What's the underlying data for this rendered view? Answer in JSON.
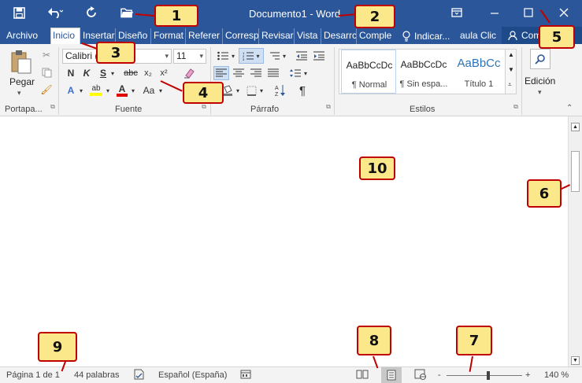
{
  "window": {
    "title": "Documento1 - Word",
    "qat": {
      "save_icon": "save-icon",
      "undo_icon": "undo-icon",
      "redo_icon": "redo-icon",
      "open_icon": "open-icon"
    },
    "controls": {
      "ribbon_display": "ribbon-display-icon",
      "minimize": "minimize-icon",
      "maximize": "maximize-icon",
      "close": "close-icon"
    }
  },
  "tabs": [
    {
      "label": "Archivo"
    },
    {
      "label": "Inicio"
    },
    {
      "label": "Insertar"
    },
    {
      "label": "Diseño"
    },
    {
      "label": "Format"
    },
    {
      "label": "Referer"
    },
    {
      "label": "Corresp"
    },
    {
      "label": "Revisar"
    },
    {
      "label": "Vista"
    },
    {
      "label": "Desarrc"
    },
    {
      "label": "Comple"
    }
  ],
  "tell_me": "Indicar...",
  "user": "aula Clic",
  "share": "Com",
  "ribbon": {
    "clipboard": {
      "paste_label": "Pegar",
      "group_label": "Portapa..."
    },
    "font": {
      "font_name": "Calibri (",
      "font_size": "11",
      "group_label": "Fuente",
      "bold": "N",
      "italic": "K",
      "underline": "S",
      "strike": "abc",
      "subscript": "x₂",
      "superscript": "x²",
      "change_case": "Aa"
    },
    "paragraph": {
      "group_label": "Párrafo"
    },
    "styles": {
      "group_label": "Estilos",
      "items": [
        {
          "sample": "AaBbCcDc",
          "name": "¶ Normal"
        },
        {
          "sample": "AaBbCcDc",
          "name": "¶ Sin espa..."
        },
        {
          "sample": "AaBbCc",
          "name": "Título 1"
        }
      ]
    },
    "editing": {
      "label": "Edición"
    }
  },
  "status": {
    "page": "Página 1 de 1",
    "words": "44 palabras",
    "language": "Español (España)",
    "zoom_minus": "-",
    "zoom_plus": "+",
    "zoom": "140 %",
    "zoom_level": 1.4
  },
  "callouts": [
    "1",
    "2",
    "3",
    "4",
    "5",
    "6",
    "7",
    "8",
    "9",
    "10"
  ],
  "colors": {
    "accent": "#2b579a",
    "callout_bg": "#fbe88a",
    "callout_border": "#c00000"
  }
}
